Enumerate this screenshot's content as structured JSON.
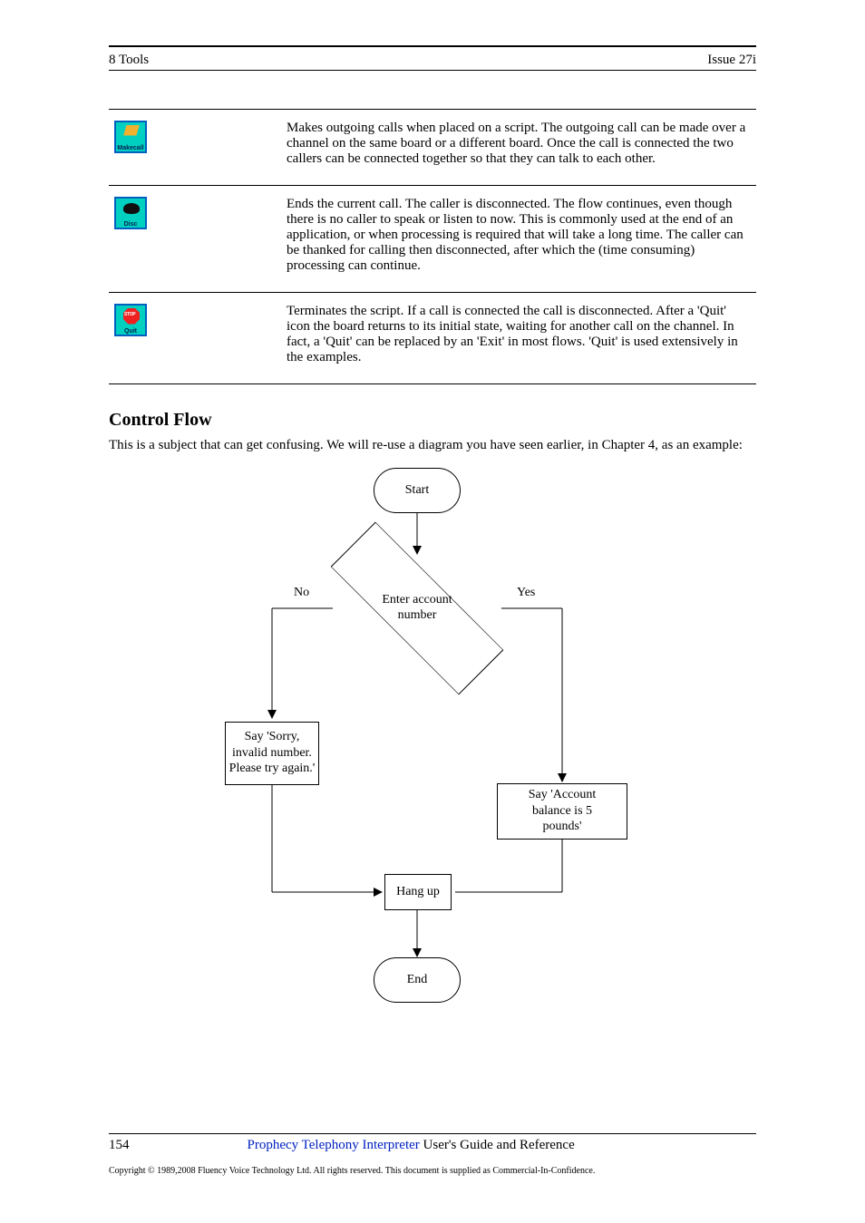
{
  "header": {
    "left": "8  Tools",
    "right": "Issue 27i"
  },
  "flows": [
    {
      "icon_name": "makecall-icon",
      "icon_label": "Makecall",
      "text": "Makes outgoing calls when placed on a script. The outgoing call can be made over a channel on the same board or a different board. Once the call is connected the two callers can be connected together so that they can talk to each other."
    },
    {
      "icon_name": "disc-icon",
      "icon_label": "Disc",
      "text": "Ends the current call. The caller is disconnected. The flow continues, even though there is no caller to speak or listen to now. This is commonly used at the end of an application, or when processing is required that will take a long time. The caller can be thanked for calling then disconnected, after which the (time consuming) processing can continue."
    },
    {
      "icon_name": "quit-icon",
      "icon_label": "Quit",
      "text": "Terminates the script. If a call is connected the call is disconnected. After a 'Quit' icon the board returns to its initial state, waiting for another call on the channel. In fact, a 'Quit' can be replaced by an 'Exit' in most flows. 'Quit' is used extensively in the examples."
    }
  ],
  "section_title": "Control Flow",
  "section_para": "This is a subject that can get confusing. We will re-use a diagram you have seen earlier, in Chapter 4, as an example:",
  "chart_data": {
    "type": "flowchart",
    "nodes": [
      {
        "id": "start",
        "shape": "terminator",
        "label": "Start"
      },
      {
        "id": "decision",
        "shape": "decision",
        "label": "Enter account\nnumber"
      },
      {
        "id": "say_invalid",
        "shape": "process",
        "label": "Say 'Sorry,\ninvalid number.\nPlease try again.'"
      },
      {
        "id": "say_balance",
        "shape": "process",
        "label": "Say 'Account\nbalance is 5\npounds'"
      },
      {
        "id": "hangup",
        "shape": "process",
        "label": "Hang up"
      },
      {
        "id": "end",
        "shape": "terminator",
        "label": "End"
      }
    ],
    "edges": [
      {
        "from": "start",
        "to": "decision"
      },
      {
        "from": "decision",
        "to": "say_invalid",
        "label": "No"
      },
      {
        "from": "decision",
        "to": "say_balance",
        "label": "Yes"
      },
      {
        "from": "say_invalid",
        "to": "hangup"
      },
      {
        "from": "say_balance",
        "to": "hangup"
      },
      {
        "from": "hangup",
        "to": "end"
      }
    ]
  },
  "footer": {
    "page_number": "154",
    "product": "Prophecy Telephony Interpreter",
    "guide": "User's Guide and Reference",
    "copyright": "Copyright © 1989,2008 Fluency Voice Technology Ltd. All rights reserved. This document is supplied as Commercial-In-Confidence."
  }
}
